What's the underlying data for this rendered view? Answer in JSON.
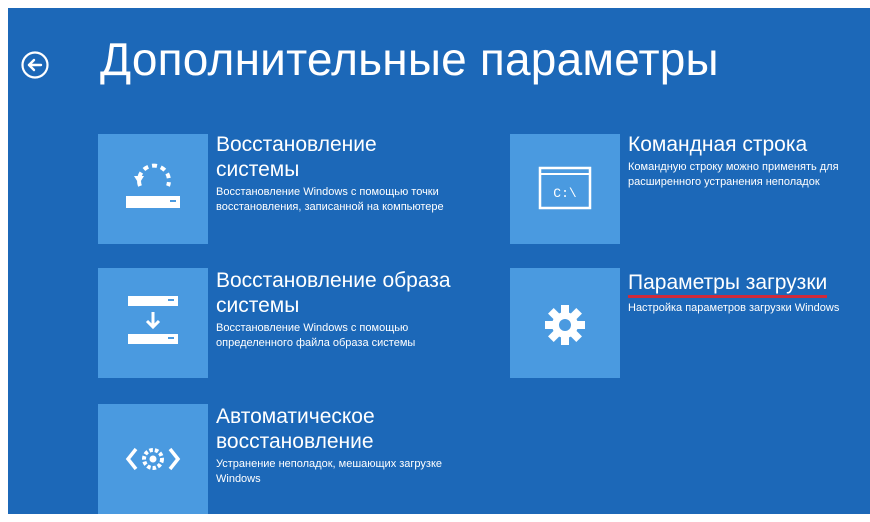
{
  "page": {
    "title": "Дополнительные параметры",
    "back_icon": "back-arrow-circle-icon"
  },
  "colors": {
    "background": "#1c68b8",
    "tile": "#4a9ae0",
    "highlight_underline": "#d02a3b"
  },
  "options": [
    {
      "title": "Восстановление системы",
      "description": "Восстановление Windows с помощью точки восстановления, записанной на компьютере",
      "icon": "system-restore-icon"
    },
    {
      "title": "Восстановление образа системы",
      "description": "Восстановление Windows с помощью определенного файла образа системы",
      "icon": "system-image-recovery-icon"
    },
    {
      "title": "Автоматическое восстановление",
      "description": "Устранение неполадок, мешающих загрузке Windows",
      "icon": "automatic-repair-icon"
    },
    {
      "title": "Командная строка",
      "description": "Командную строку можно применять для расширенного устранения неполадок",
      "icon": "command-prompt-icon",
      "icon_text": "C:\\"
    },
    {
      "title": "Параметры загрузки",
      "description": "Настройка параметров загрузки Windows",
      "icon": "gear-icon"
    }
  ]
}
